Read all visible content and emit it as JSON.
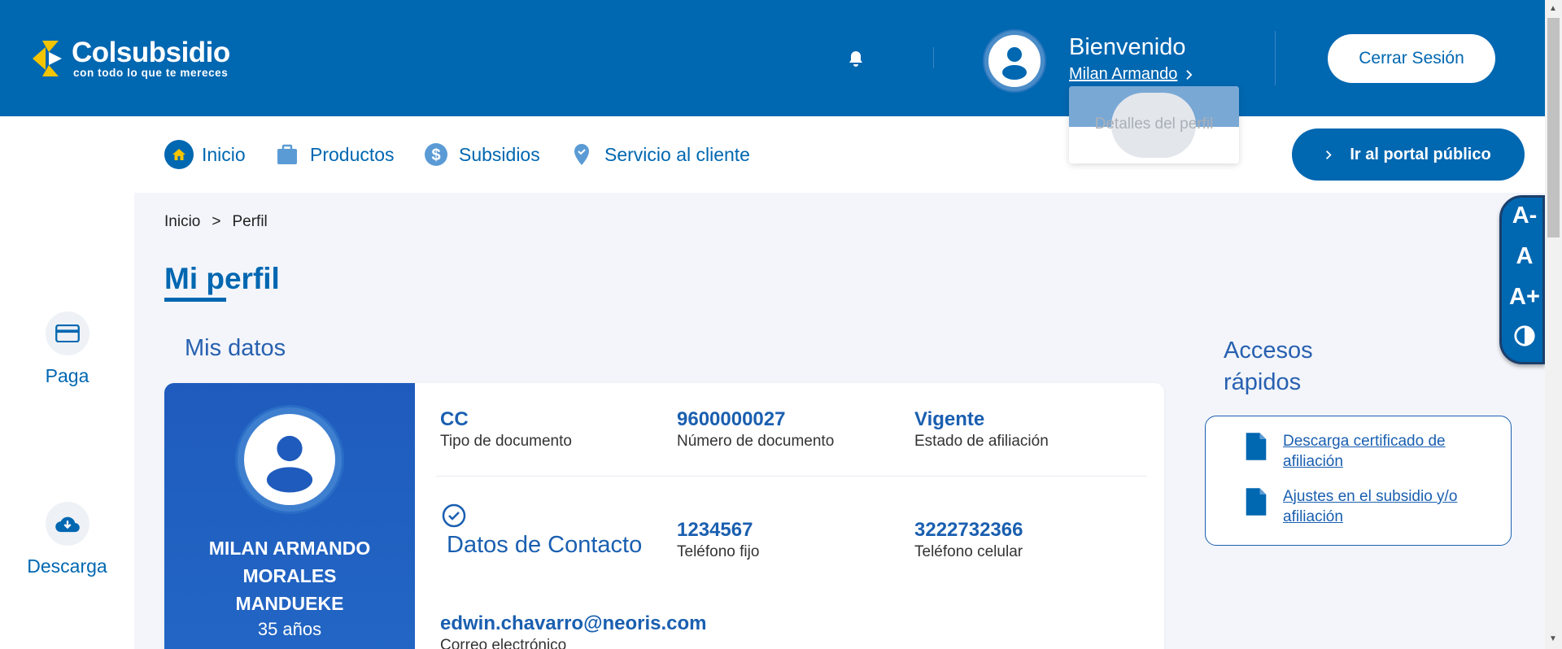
{
  "header": {
    "logo_main": "Colsubsidio",
    "logo_sub": "con todo lo que te mereces",
    "welcome": "Bienvenido",
    "user_name": "Milan Armando",
    "logout_label": "Cerrar Sesión"
  },
  "dropdown": {
    "item": "Detalles del perfil"
  },
  "nav": {
    "items": [
      {
        "label": "Inicio",
        "icon": "home-icon"
      },
      {
        "label": "Productos",
        "icon": "briefcase-icon"
      },
      {
        "label": "Subsidios",
        "icon": "dollar-icon"
      },
      {
        "label": "Servicio al cliente",
        "icon": "location-pin-icon"
      }
    ],
    "portal_label": "Ir al portal público"
  },
  "sidebar": {
    "items": [
      {
        "label": "Paga",
        "icon": "credit-card-icon"
      },
      {
        "label": "Descarga",
        "icon": "cloud-download-icon"
      }
    ]
  },
  "breadcrumb": {
    "home": "Inicio",
    "separator": ">",
    "current": "Perfil"
  },
  "page_title": "Mi perfil",
  "profile": {
    "section_title": "Mis datos",
    "name_line1": "MILAN ARMANDO",
    "name_line2": "MORALES",
    "name_line3": "MANDUEKE",
    "age": "35 años",
    "doc_type": {
      "value": "CC",
      "label": "Tipo de documento"
    },
    "doc_number": {
      "value": "9600000027",
      "label": "Número de documento"
    },
    "status": {
      "value": "Vigente",
      "label": "Estado de afiliación"
    },
    "contact_title": "Datos de Contacto",
    "phone": {
      "value": "1234567",
      "label": "Teléfono fijo"
    },
    "mobile": {
      "value": "3222732366",
      "label": "Teléfono celular"
    },
    "email": {
      "value": "edwin.chavarro@neoris.com",
      "label": "Correo electrónico"
    }
  },
  "quick_access": {
    "title_line1": "Accesos",
    "title_line2": "rápidos",
    "links": [
      "Descarga certificado de afiliación",
      "Ajustes en el subsidio y/o afiliación"
    ]
  },
  "a11y": {
    "decrease": "A-",
    "normal": "A",
    "increase": "A+"
  },
  "colors": {
    "primary": "#0067b1",
    "card_blue": "#2266c4",
    "background": "#f3f5fa"
  }
}
